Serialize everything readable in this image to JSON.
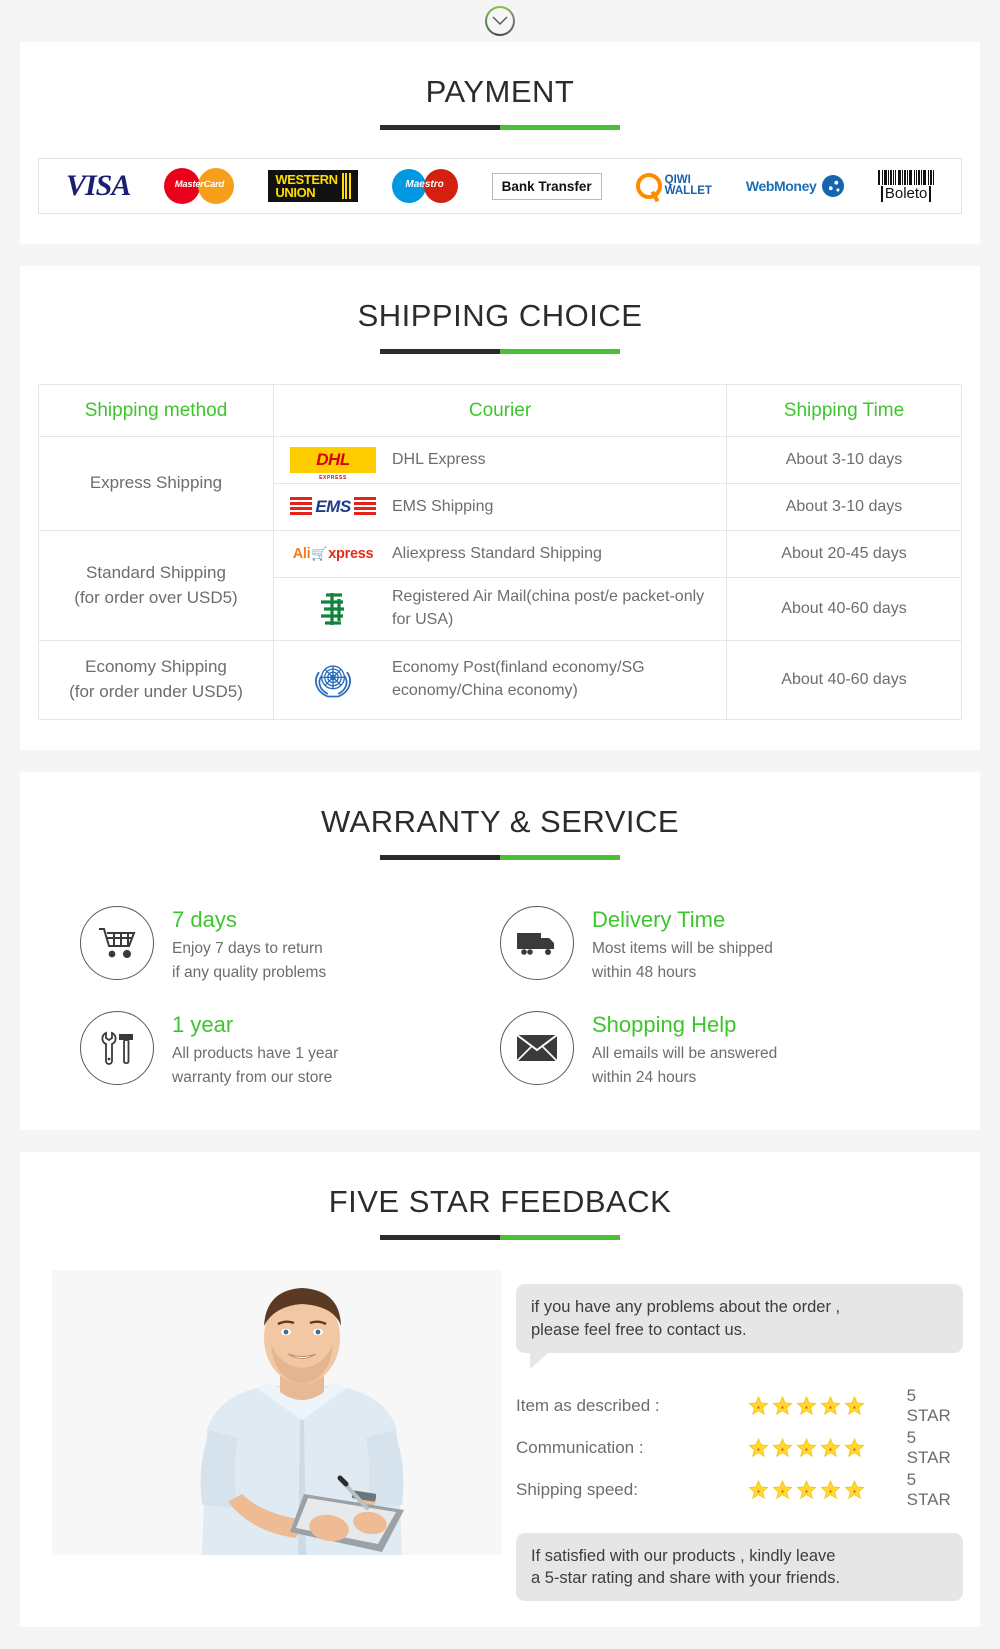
{
  "top": {
    "chevron_icon": "chevron-down-icon"
  },
  "payment": {
    "title": "PAYMENT",
    "methods": [
      {
        "name": "visa",
        "label": "VISA"
      },
      {
        "name": "mastercard",
        "label": "MasterCard"
      },
      {
        "name": "western-union",
        "label_1": "WESTERN",
        "label_2": "UNION"
      },
      {
        "name": "maestro",
        "label": "Maestro"
      },
      {
        "name": "bank-transfer",
        "label": "Bank Transfer"
      },
      {
        "name": "qiwi-wallet",
        "label_1": "QIWI",
        "label_2": "WALLET"
      },
      {
        "name": "webmoney",
        "label": "WebMoney"
      },
      {
        "name": "boleto",
        "label": "Boleto"
      }
    ]
  },
  "shipping": {
    "title": "SHIPPING CHOICE",
    "headers": [
      "Shipping method",
      "Courier",
      "Shipping Time"
    ],
    "groups": [
      {
        "method": "Express Shipping",
        "rows": [
          {
            "logo": "dhl-logo",
            "courier": "DHL Express",
            "time": "About 3-10 days"
          },
          {
            "logo": "ems-logo",
            "courier": "EMS Shipping",
            "time": "About 3-10 days"
          }
        ]
      },
      {
        "method": "Standard Shipping\n(for order over USD5)",
        "rows": [
          {
            "logo": "aliexpress-logo",
            "courier": "Aliexpress Standard Shipping",
            "time": "About 20-45 days"
          },
          {
            "logo": "china-post-logo",
            "courier": "Registered Air Mail(china post/e packet-only for USA)",
            "time": "About 40-60 days"
          }
        ]
      },
      {
        "method": "Economy Shipping\n(for order under USD5)",
        "rows": [
          {
            "logo": "un-post-logo",
            "courier": "Economy Post(finland economy/SG economy/China economy)",
            "time": "About 40-60 days"
          }
        ]
      }
    ]
  },
  "warranty": {
    "title": "WARRANTY & SERVICE",
    "items": [
      {
        "icon": "shopping-cart-icon",
        "title": "7 days",
        "line1": "Enjoy 7 days to return",
        "line2": "if any quality problems"
      },
      {
        "icon": "delivery-truck-icon",
        "title": "Delivery Time",
        "line1": "Most items will be shipped",
        "line2": "within 48 hours"
      },
      {
        "icon": "tools-icon",
        "title": "1 year",
        "line1": "All products have 1 year",
        "line2": "warranty from our store"
      },
      {
        "icon": "envelope-icon",
        "title": "Shopping Help",
        "line1": "All emails will be answered",
        "line2": "within 24 hours"
      }
    ]
  },
  "feedback": {
    "title": "FIVE STAR FEEDBACK",
    "photo_alt": "smiling-man-with-clipboard",
    "bubble_top_line1": "if you have any problems about the order ,",
    "bubble_top_line2": "please feel free to contact us.",
    "ratings": [
      {
        "label": "Item as described :",
        "stars": 5,
        "value": "5 STAR"
      },
      {
        "label": "Communication :",
        "stars": 5,
        "value": "5 STAR"
      },
      {
        "label": "Shipping speed:",
        "stars": 5,
        "value": "5 STAR"
      }
    ],
    "bubble_bottom_line1": "If satisfied with our products ,  kindly leave",
    "bubble_bottom_line2": "a 5-star rating and share with your friends."
  },
  "colors": {
    "accent_green": "#3ec52e",
    "rule_dark": "#2b2b2b",
    "rule_green": "#4cc035",
    "text_gray": "#6d6d6d",
    "page_bg": "#f5f5f5"
  }
}
